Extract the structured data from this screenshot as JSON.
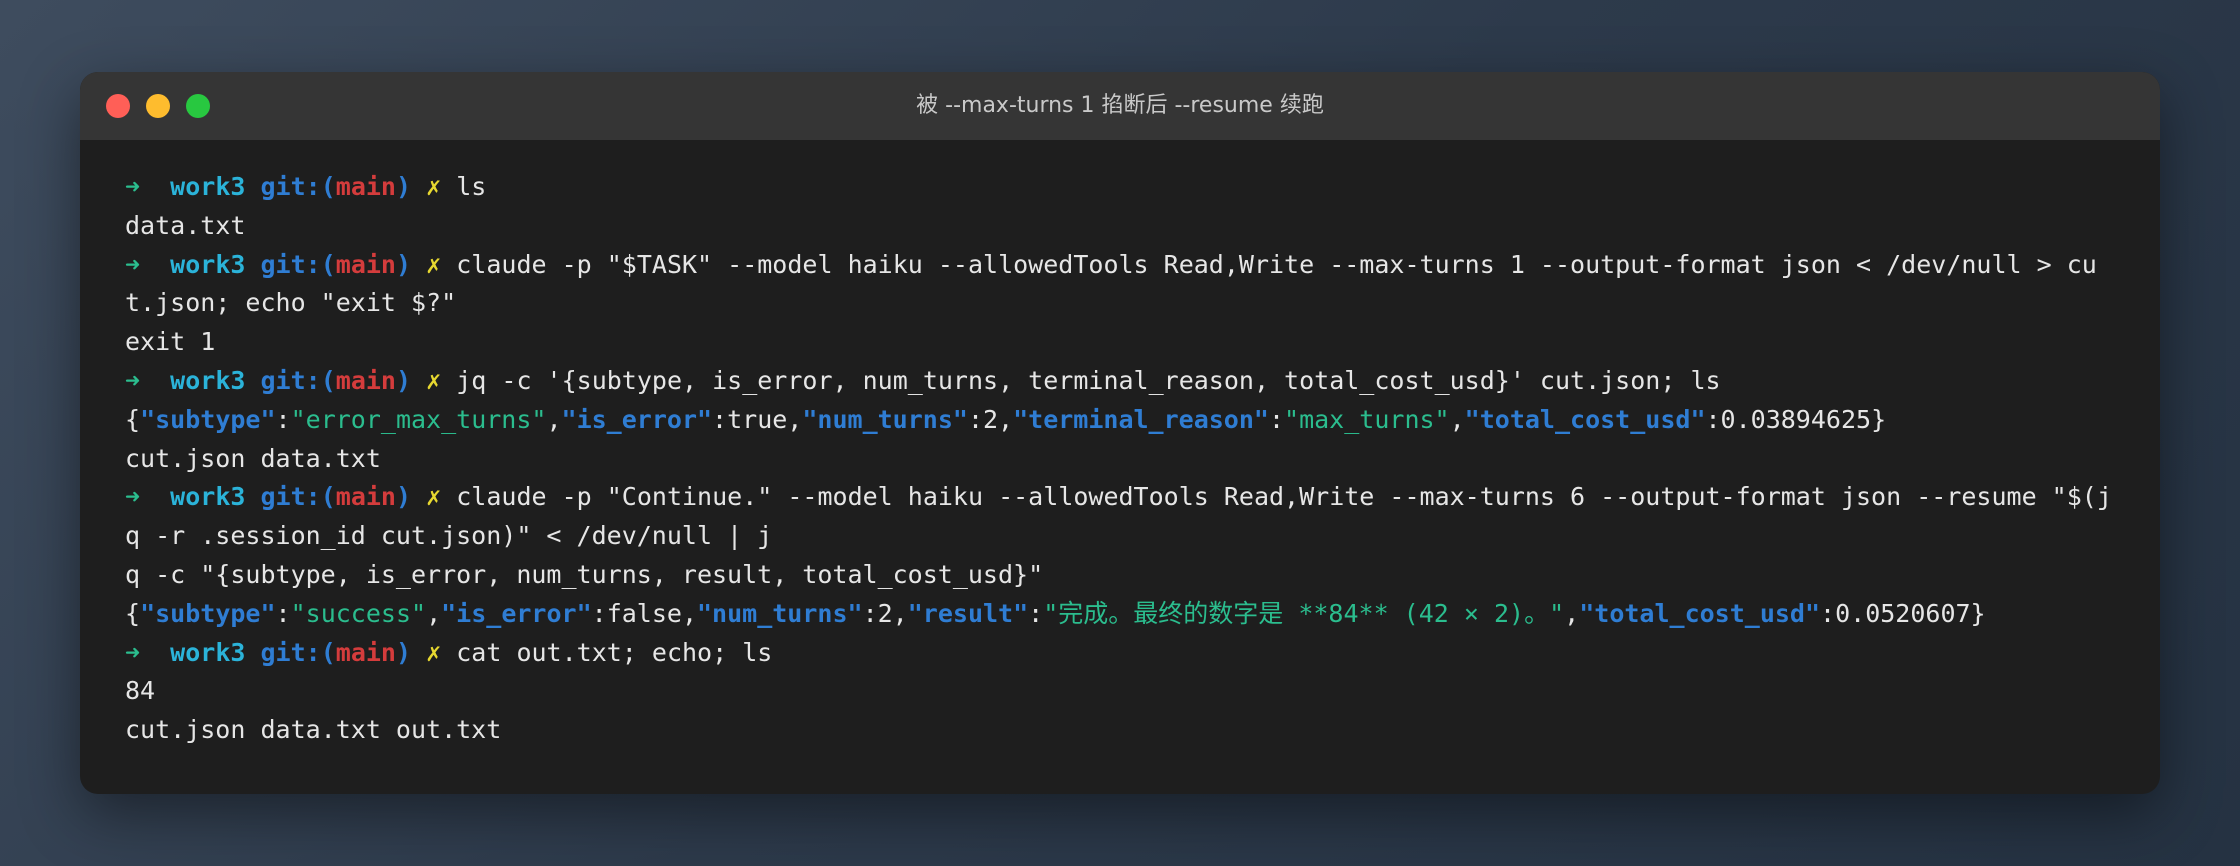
{
  "window": {
    "title": "被 --max-turns 1 掐断后 --resume 续跑"
  },
  "prompt": {
    "arrow": "➜",
    "dir": "work3",
    "git_prefix": "git:(",
    "branch": "main",
    "git_suffix": ")",
    "dirty": "✗"
  },
  "terminal": {
    "lines": [
      {
        "kind": "cmd",
        "text": "ls"
      },
      {
        "kind": "out",
        "text": "data.txt"
      },
      {
        "kind": "cmd",
        "text": "claude -p \"$TASK\" --model haiku --allowedTools Read,Write --max-turns 1 --output-format json < /dev/null > cu"
      },
      {
        "kind": "out",
        "text": "t.json; echo \"exit $?\""
      },
      {
        "kind": "out",
        "text": "exit 1"
      },
      {
        "kind": "cmd",
        "text": "jq -c '{subtype, is_error, num_turns, terminal_reason, total_cost_usd}' cut.json; ls"
      },
      {
        "kind": "json",
        "segments": [
          {
            "t": "p",
            "v": "{"
          },
          {
            "t": "k",
            "v": "\"subtype\""
          },
          {
            "t": "p",
            "v": ":"
          },
          {
            "t": "s",
            "v": "\"error_max_turns\""
          },
          {
            "t": "p",
            "v": ","
          },
          {
            "t": "k",
            "v": "\"is_error\""
          },
          {
            "t": "p",
            "v": ":true,"
          },
          {
            "t": "k",
            "v": "\"num_turns\""
          },
          {
            "t": "p",
            "v": ":2,"
          },
          {
            "t": "k",
            "v": "\"terminal_reason\""
          },
          {
            "t": "p",
            "v": ":"
          },
          {
            "t": "s",
            "v": "\"max_turns\""
          },
          {
            "t": "p",
            "v": ","
          },
          {
            "t": "k",
            "v": "\"total_cost_usd\""
          },
          {
            "t": "p",
            "v": ":0.03894625}"
          }
        ]
      },
      {
        "kind": "out",
        "text": "cut.json data.txt"
      },
      {
        "kind": "cmd",
        "text": "claude -p \"Continue.\" --model haiku --allowedTools Read,Write --max-turns 6 --output-format json --resume \"$(j"
      },
      {
        "kind": "out",
        "text": "q -r .session_id cut.json)\" < /dev/null | j"
      },
      {
        "kind": "out",
        "text": "q -c \"{subtype, is_error, num_turns, result, total_cost_usd}\""
      },
      {
        "kind": "json",
        "segments": [
          {
            "t": "p",
            "v": "{"
          },
          {
            "t": "k",
            "v": "\"subtype\""
          },
          {
            "t": "p",
            "v": ":"
          },
          {
            "t": "s",
            "v": "\"success\""
          },
          {
            "t": "p",
            "v": ","
          },
          {
            "t": "k",
            "v": "\"is_error\""
          },
          {
            "t": "p",
            "v": ":false,"
          },
          {
            "t": "k",
            "v": "\"num_turns\""
          },
          {
            "t": "p",
            "v": ":2,"
          },
          {
            "t": "k",
            "v": "\"result\""
          },
          {
            "t": "p",
            "v": ":"
          },
          {
            "t": "s",
            "v": "\"完成。最终的数字是 **84** (42 × 2)。\""
          },
          {
            "t": "p",
            "v": ","
          },
          {
            "t": "k",
            "v": "\"total_cost_usd\""
          },
          {
            "t": "p",
            "v": ":0.0520607}"
          }
        ]
      },
      {
        "kind": "cmd",
        "text": "cat out.txt; echo; ls"
      },
      {
        "kind": "out",
        "text": "84"
      },
      {
        "kind": "out",
        "text": "cut.json data.txt out.txt"
      }
    ]
  }
}
